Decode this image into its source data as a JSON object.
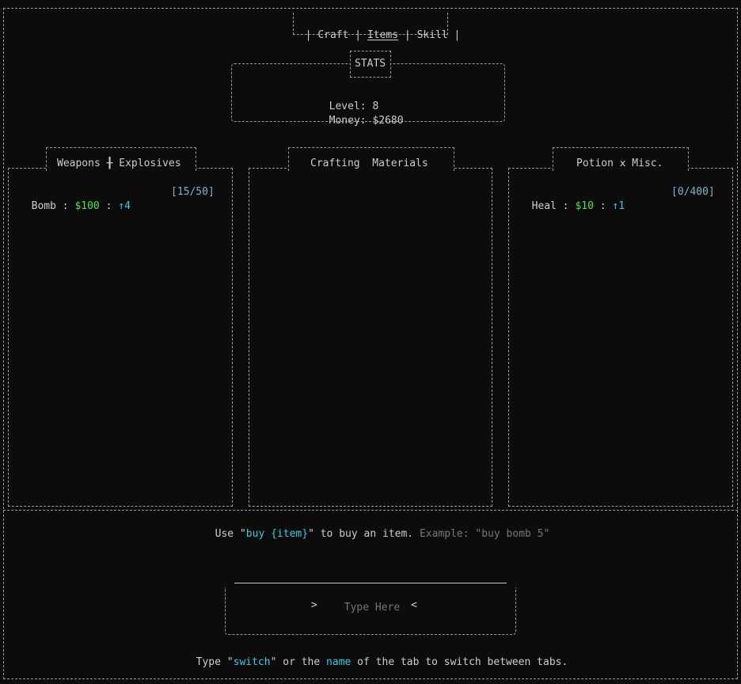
{
  "tabs": {
    "items": [
      {
        "label": "Craft"
      },
      {
        "label": "Items"
      },
      {
        "label": "Skill"
      }
    ],
    "active_index": 1
  },
  "stats": {
    "title": "STATS",
    "level_label": "Level:",
    "level_value": "8",
    "money_label": "Money:",
    "money_value": "$2680"
  },
  "panels": {
    "weapons": {
      "title": "Weapons ╂ Explosives",
      "items": [
        {
          "name": "Bomb",
          "price": "$100",
          "level": "↑4",
          "stock": "[15/50]"
        }
      ]
    },
    "crafting": {
      "title": "Crafting  Materials",
      "items": []
    },
    "potion": {
      "title": "Potion ⅹ Misc.",
      "items": [
        {
          "name": "Heal",
          "price": "$10",
          "level": "↑1",
          "stock": "[0/400]"
        }
      ]
    }
  },
  "hint_buy": {
    "prefix": "Use \"",
    "command": "buy {item}",
    "middle": "\" to buy an item.",
    "example": "Example: \"buy bomb 5\""
  },
  "input": {
    "left_marker": ">",
    "placeholder": "Type Here",
    "right_marker": "<"
  },
  "hint_switch": {
    "prefix": "Type \"",
    "command": "switch",
    "middle": "\" or the ",
    "keyword": "name",
    "suffix": " of the tab to switch between tabs."
  },
  "colors": {
    "background": "#0c0c0c",
    "text": "#cccccc",
    "price": "#4ce34c",
    "command": "#3fc8e4",
    "muted": "#767676",
    "stock": "#7fb2c8"
  }
}
